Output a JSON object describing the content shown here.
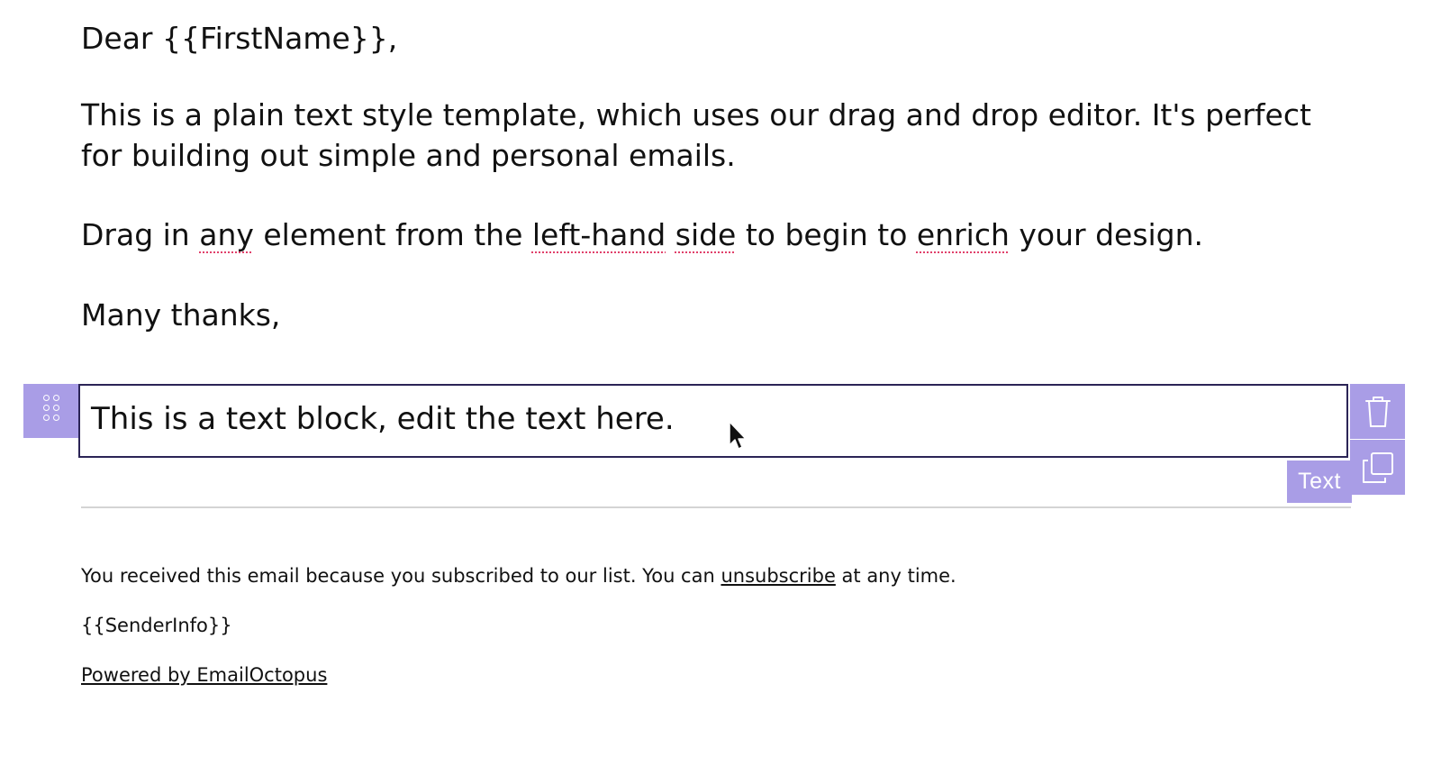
{
  "email": {
    "greeting": "Dear {{FirstName}},",
    "intro": "This is a plain text style template, which uses our drag and drop editor. It's perfect for building out simple and personal emails.",
    "drag_parts": {
      "p1": "Drag in ",
      "w1": "any",
      "p2": " element from the ",
      "w2": "left-hand",
      "p3": " ",
      "w3": "side",
      "p4": " to begin to ",
      "w4": "enrich",
      "p5": " your design."
    },
    "signoff": "Many thanks,"
  },
  "selected_block": {
    "text": "This is a text block, edit the text here.",
    "type_label": "Text"
  },
  "footer": {
    "notice_before": "You received this email because you subscribed to our list. You can ",
    "unsubscribe_link": "unsubscribe",
    "notice_after": " at any time.",
    "sender_info": "{{SenderInfo}}",
    "powered_by": "Powered by EmailOctopus"
  },
  "icons": {
    "drag": "drag-dots-icon",
    "delete": "trash-icon",
    "duplicate": "duplicate-icon",
    "cursor": "mouse-pointer-icon"
  },
  "colors": {
    "accent": "#a99de6",
    "selection_border": "#2b2456",
    "spellcheck": "#e0406a",
    "divider": "#d4d4d4"
  }
}
